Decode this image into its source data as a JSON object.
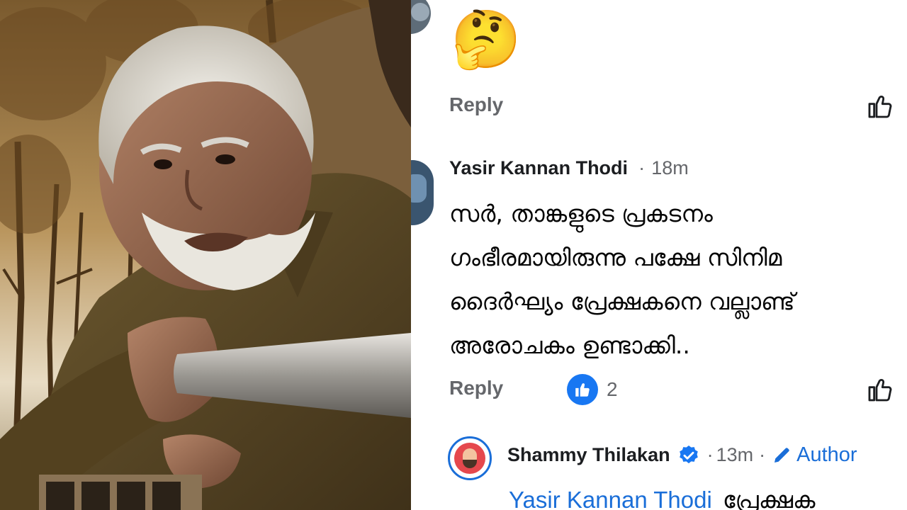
{
  "photo": {
    "subject": "movie-still-elderly-man-leaning-on-railing"
  },
  "first_comment": {
    "emoji": "🤔",
    "reply_label": "Reply",
    "like_icon": "thumbs-up-outline-icon"
  },
  "second_comment": {
    "author": "Yasir Kannan Thodi",
    "separator": "·",
    "time": "18m",
    "body_lines": [
      "സർ, താങ്കളുടെ പ്രകടനം",
      "ഗംഭീരമായിരുന്നു പക്ഷേ സിനിമ",
      "ദൈർഘ്യം പ്രേക്ഷകനെ വല്ലാണ്ട്",
      "അരോചകം ഉണ്ടാക്കി.."
    ],
    "reply_label": "Reply",
    "reaction_count": "2",
    "reaction_icon": "like-reaction-badge-icon",
    "like_icon": "thumbs-up-outline-icon"
  },
  "nested_reply": {
    "author": "Shammy Thilakan",
    "verified_icon": "verified-badge-icon",
    "separator": "·",
    "time": "13m",
    "separator2": "·",
    "author_label": "Author",
    "author_icon": "pencil-icon",
    "mention": "Yasir Kannan Thodi",
    "body_start": "പ്രേക്ഷക"
  },
  "colors": {
    "accent": "#1a6ed8",
    "meta": "#65676b",
    "text": "#050505",
    "like_blue": "#1877f2"
  }
}
